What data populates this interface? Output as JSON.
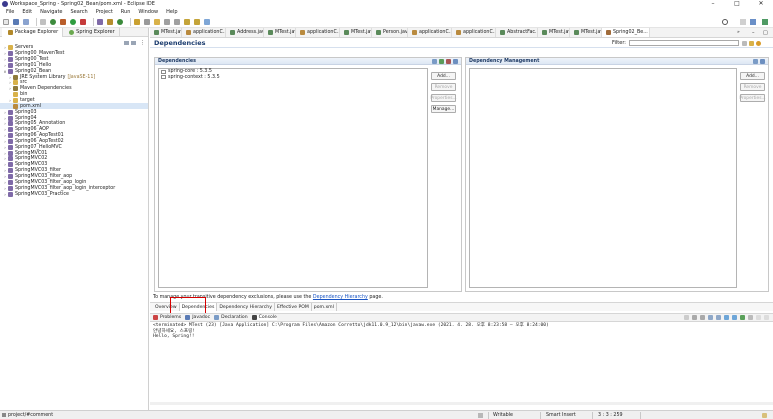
{
  "window": {
    "title": "Workspace_Spring - Spring02_Bean/pom.xml - Eclipse IDE",
    "controls": [
      "–",
      "□",
      "✕"
    ]
  },
  "menu": [
    "File",
    "Edit",
    "Navigate",
    "Search",
    "Project",
    "Run",
    "Window",
    "Help"
  ],
  "package_explorer": {
    "tabs": [
      {
        "label": "Package Explorer",
        "icon": "package-icon"
      },
      {
        "label": "Spring Explorer",
        "icon": "spring-icon"
      }
    ],
    "tree": [
      {
        "label": "Servers",
        "icon": "folder-icon",
        "depth": 0,
        "arrow": ">"
      },
      {
        "label": "Spring00_MavenTest",
        "icon": "project-icon",
        "depth": 0,
        "arrow": ">"
      },
      {
        "label": "Spring00_Test",
        "icon": "project-icon",
        "depth": 0,
        "arrow": ">"
      },
      {
        "label": "Spring01_Hello",
        "icon": "project-icon",
        "depth": 0,
        "arrow": ">"
      },
      {
        "label": "Spring02_Bean",
        "icon": "project-icon",
        "depth": 0,
        "arrow": "v"
      },
      {
        "label": "JRE System Library",
        "suffix": "[JavaSE-11]",
        "icon": "library-icon",
        "depth": 1,
        "arrow": ">"
      },
      {
        "label": "src",
        "icon": "folder-icon",
        "depth": 1,
        "arrow": ">"
      },
      {
        "label": "Maven Dependencies",
        "icon": "library-icon",
        "depth": 1,
        "arrow": ">"
      },
      {
        "label": "bin",
        "icon": "folder-icon",
        "depth": 1,
        "arrow": ""
      },
      {
        "label": "target",
        "icon": "folder-icon",
        "depth": 1,
        "arrow": ">"
      },
      {
        "label": "pom.xml",
        "icon": "xml-file-icon",
        "depth": 1,
        "arrow": "",
        "selected": true
      },
      {
        "label": "Spring03",
        "icon": "project-icon",
        "depth": 0,
        "arrow": ">"
      },
      {
        "label": "Spring04",
        "icon": "project-icon",
        "depth": 0,
        "arrow": ">"
      },
      {
        "label": "Spring05_Annotation",
        "icon": "project-icon",
        "depth": 0,
        "arrow": ">"
      },
      {
        "label": "Spring06_AOP",
        "icon": "project-icon",
        "depth": 0,
        "arrow": ">"
      },
      {
        "label": "Spring06_AopTest01",
        "icon": "project-icon",
        "depth": 0,
        "arrow": ">"
      },
      {
        "label": "Spring06_AopTest02",
        "icon": "project-icon",
        "depth": 0,
        "arrow": ">"
      },
      {
        "label": "Spring07_HelloMVC",
        "icon": "project-icon",
        "depth": 0,
        "arrow": ">"
      },
      {
        "label": "SpringMVC01",
        "icon": "project-icon",
        "depth": 0,
        "arrow": ">"
      },
      {
        "label": "SpringMVC02",
        "icon": "project-icon",
        "depth": 0,
        "arrow": ">"
      },
      {
        "label": "SpringMVC03",
        "icon": "project-icon",
        "depth": 0,
        "arrow": ">"
      },
      {
        "label": "SpringMVC03_filter",
        "icon": "project-icon",
        "depth": 0,
        "arrow": ">"
      },
      {
        "label": "SpringMVC03_filter_aop",
        "icon": "project-icon",
        "depth": 0,
        "arrow": ">"
      },
      {
        "label": "SpringMVC03_filter_aop_login",
        "icon": "project-icon",
        "depth": 0,
        "arrow": ">"
      },
      {
        "label": "SpringMVC03_filter_aop_login_interceptor",
        "icon": "project-icon",
        "depth": 0,
        "arrow": ">"
      },
      {
        "label": "SpringMVC03_Practice",
        "icon": "project-icon",
        "depth": 0,
        "arrow": ">"
      }
    ]
  },
  "editor_tabs": [
    {
      "label": "MTest.java",
      "icon": "java-file-icon",
      "width": 32
    },
    {
      "label": "applicationC...",
      "icon": "xml-file-icon",
      "width": 44
    },
    {
      "label": "Address.java",
      "icon": "java-file-icon",
      "width": 38
    },
    {
      "label": "MTest.java",
      "icon": "java-file-icon",
      "width": 32
    },
    {
      "label": "applicationC...",
      "icon": "xml-file-icon",
      "width": 44
    },
    {
      "label": "MTest.java",
      "icon": "java-file-icon",
      "width": 32
    },
    {
      "label": "Person.java",
      "icon": "java-file-icon",
      "width": 36
    },
    {
      "label": "applicationC...",
      "icon": "xml-file-icon",
      "width": 44
    },
    {
      "label": "applicationC...",
      "icon": "xml-file-icon",
      "width": 44
    },
    {
      "label": "AbstractFac...",
      "icon": "java-file-icon",
      "width": 42
    },
    {
      "label": "MTest.java",
      "icon": "java-file-icon",
      "width": 32
    },
    {
      "label": "MTest.java",
      "icon": "java-file-icon",
      "width": 32
    },
    {
      "label": "Spring02_Be...",
      "icon": "pom-file-icon",
      "width": 48,
      "active": true
    }
  ],
  "editor": {
    "heading": "Dependencies",
    "filter_label": "Filter:",
    "dependencies": {
      "title": "Dependencies",
      "items": [
        "spring-core : 5.3.5",
        "spring-context : 5.3.5"
      ],
      "buttons": [
        {
          "label": "Add...",
          "enabled": true
        },
        {
          "label": "Remove",
          "enabled": false
        },
        {
          "label": "Properties...",
          "enabled": false
        },
        {
          "label": "Manage...",
          "enabled": true
        }
      ]
    },
    "dependency_management": {
      "title": "Dependency Management",
      "buttons": [
        {
          "label": "Add...",
          "enabled": true
        },
        {
          "label": "Remove",
          "enabled": false
        },
        {
          "label": "Properties...",
          "enabled": false
        }
      ]
    },
    "note_prefix": "To manage your transitive dependency exclusions, please use the",
    "note_link": "Dependency Hierarchy",
    "note_suffix": "page.",
    "sub_tabs": [
      "Overview",
      "Dependencies",
      "Dependency Hierarchy",
      "Effective POM",
      "pom.xml"
    ],
    "active_sub_tab": 1
  },
  "console": {
    "tabs": [
      {
        "label": "Problems",
        "icon": "problems-icon"
      },
      {
        "label": "Javadoc",
        "icon": "javadoc-icon"
      },
      {
        "label": "Declaration",
        "icon": "declaration-icon"
      },
      {
        "label": "Console",
        "icon": "console-icon",
        "active": true
      }
    ],
    "header": "<terminated> MTest (23) [Java Application] C:\\Program Files\\Amazon Corretto\\jdk11.0.9_12\\bin\\javaw.exe  (2021. 4. 28. 오후 8:23:58 – 오후 8:24:00)",
    "lines": [
      "안녕하세요, 스프링!",
      "Hello, Spring!!"
    ]
  },
  "status": {
    "left": "project/#comment",
    "writable": "Writable",
    "insert": "Smart Insert",
    "position": "3 : 3 : 259"
  },
  "colors": {
    "accent": "#1f3b66",
    "highlight_box": "#d60000",
    "link": "#1a55c4"
  }
}
